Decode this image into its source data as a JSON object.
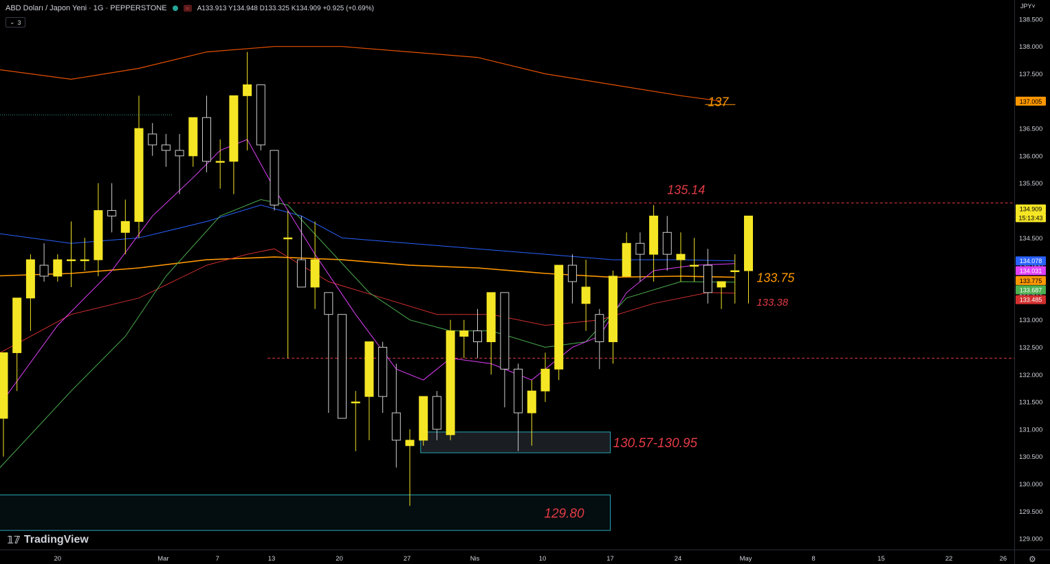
{
  "header": {
    "symbol": "ABD Doları / Japon Yeni · 1G · PEPPERSTONE",
    "ohlc": "A133.913 Y134.948 D133.325 K134.909 +0.925 (+0.69%)",
    "indicator_count": "3"
  },
  "currency_label": "JPY",
  "logo_text": "TradingView",
  "colors": {
    "bull": "#f5e625",
    "bear": "#000000",
    "axis_text": "#d1d4dc",
    "level_line": "#c0282e",
    "zone_border": "#2aa7b8"
  },
  "chart_data": {
    "type": "candlestick",
    "ylim": [
      128.8,
      138.85
    ],
    "y_ticks": [
      129.0,
      129.5,
      130.0,
      130.5,
      131.0,
      131.5,
      132.0,
      132.5,
      133.0,
      133.5,
      134.0,
      134.5,
      135.0,
      135.5,
      136.0,
      136.5,
      137.0,
      137.5,
      138.0,
      138.5
    ],
    "x_ticks": [
      {
        "label": "13",
        "i": -1
      },
      {
        "label": "20",
        "i": 4
      },
      {
        "label": "Mar",
        "i": 11.8
      },
      {
        "label": "7",
        "i": 15.8
      },
      {
        "label": "13",
        "i": 19.8
      },
      {
        "label": "20",
        "i": 24.8
      },
      {
        "label": "27",
        "i": 29.8
      },
      {
        "label": "Nis",
        "i": 34.8
      },
      {
        "label": "10",
        "i": 39.8
      },
      {
        "label": "17",
        "i": 44.8
      },
      {
        "label": "24",
        "i": 49.8
      },
      {
        "label": "May",
        "i": 54.8
      },
      {
        "label": "8",
        "i": 59.8
      },
      {
        "label": "15",
        "i": 64.8
      },
      {
        "label": "22",
        "i": 69.8
      },
      {
        "label": "26",
        "i": 73.8
      }
    ],
    "ohlc": [
      [
        131.2,
        131.6,
        130.5,
        132.4
      ],
      [
        132.4,
        133.3,
        131.7,
        133.4
      ],
      [
        133.4,
        134.2,
        132.8,
        134.1
      ],
      [
        134.0,
        134.4,
        133.7,
        133.8
      ],
      [
        133.8,
        134.2,
        133.7,
        134.1
      ],
      [
        134.1,
        134.8,
        133.6,
        134.1
      ],
      [
        134.1,
        134.5,
        133.9,
        134.1
      ],
      [
        134.1,
        135.5,
        133.8,
        135.0
      ],
      [
        135.0,
        135.5,
        134.6,
        134.9
      ],
      [
        134.6,
        135.2,
        134.2,
        134.8
      ],
      [
        134.8,
        137.1,
        134.5,
        136.5
      ],
      [
        136.4,
        136.6,
        136.0,
        136.2
      ],
      [
        136.2,
        136.4,
        135.8,
        136.1
      ],
      [
        136.1,
        136.4,
        135.3,
        136.0
      ],
      [
        136.0,
        136.7,
        135.8,
        136.7
      ],
      [
        136.7,
        137.1,
        135.7,
        135.9
      ],
      [
        135.9,
        136.3,
        135.4,
        135.9
      ],
      [
        135.9,
        137.1,
        135.3,
        137.1
      ],
      [
        137.1,
        137.9,
        136.1,
        137.3
      ],
      [
        137.3,
        137.3,
        136.1,
        136.2
      ],
      [
        136.1,
        136.1,
        135.0,
        135.1
      ],
      [
        134.5,
        135.0,
        132.3,
        134.5
      ],
      [
        134.1,
        134.9,
        133.7,
        133.6
      ],
      [
        133.6,
        134.8,
        133.2,
        134.1
      ],
      [
        133.5,
        133.5,
        131.3,
        133.1
      ],
      [
        133.1,
        133.1,
        131.2,
        131.2
      ],
      [
        131.5,
        131.7,
        130.6,
        131.5
      ],
      [
        131.6,
        132.5,
        130.8,
        132.6
      ],
      [
        132.5,
        132.6,
        131.3,
        131.6
      ],
      [
        131.3,
        132.2,
        130.3,
        130.8
      ],
      [
        130.7,
        131.0,
        129.6,
        130.8
      ],
      [
        130.8,
        131.6,
        130.7,
        131.6
      ],
      [
        131.6,
        131.7,
        130.8,
        131.0
      ],
      [
        130.9,
        133.0,
        130.8,
        132.8
      ],
      [
        132.7,
        133.0,
        132.3,
        132.8
      ],
      [
        132.8,
        133.2,
        132.3,
        132.6
      ],
      [
        132.6,
        133.3,
        132.0,
        133.5
      ],
      [
        133.5,
        133.5,
        131.4,
        132.1
      ],
      [
        132.1,
        132.2,
        130.6,
        131.3
      ],
      [
        131.3,
        131.9,
        130.7,
        131.7
      ],
      [
        131.7,
        132.4,
        131.5,
        132.1
      ],
      [
        132.1,
        133.8,
        131.9,
        134.0
      ],
      [
        134.0,
        134.2,
        133.3,
        133.7
      ],
      [
        133.3,
        134.1,
        132.8,
        133.6
      ],
      [
        133.1,
        133.2,
        132.1,
        132.6
      ],
      [
        132.6,
        133.9,
        132.2,
        133.8
      ],
      [
        133.8,
        134.6,
        133.8,
        134.4
      ],
      [
        134.4,
        134.6,
        133.7,
        134.2
      ],
      [
        134.2,
        135.1,
        133.7,
        134.9
      ],
      [
        134.6,
        134.9,
        133.9,
        134.2
      ],
      [
        134.1,
        134.6,
        133.7,
        134.2
      ],
      [
        134.0,
        134.5,
        133.7,
        134.0
      ],
      [
        134.0,
        134.3,
        133.3,
        133.5
      ],
      [
        133.6,
        133.7,
        133.2,
        133.7
      ],
      [
        133.9,
        134.2,
        133.3,
        133.9
      ],
      [
        133.9,
        134.9,
        133.3,
        134.9
      ]
    ],
    "moving_averages": [
      {
        "color": "#ff9800",
        "width": 1.6,
        "points": [
          [
            -1,
            133.8
          ],
          [
            5,
            133.85
          ],
          [
            10,
            133.95
          ],
          [
            15,
            134.1
          ],
          [
            20,
            134.15
          ],
          [
            25,
            134.1
          ],
          [
            30,
            134.0
          ],
          [
            35,
            133.95
          ],
          [
            40,
            133.85
          ],
          [
            45,
            133.78
          ],
          [
            50,
            133.8
          ],
          [
            54,
            133.78
          ]
        ]
      },
      {
        "color": "#e65100",
        "width": 1.2,
        "points": [
          [
            -1,
            137.6
          ],
          [
            5,
            137.4
          ],
          [
            10,
            137.6
          ],
          [
            15,
            137.9
          ],
          [
            20,
            138.0
          ],
          [
            25,
            138.0
          ],
          [
            30,
            137.9
          ],
          [
            35,
            137.8
          ],
          [
            40,
            137.5
          ],
          [
            45,
            137.3
          ],
          [
            50,
            137.1
          ],
          [
            53,
            137.0
          ]
        ]
      },
      {
        "color": "#2962ff",
        "width": 1.0,
        "points": [
          [
            -1,
            134.6
          ],
          [
            5,
            134.4
          ],
          [
            10,
            134.5
          ],
          [
            15,
            134.8
          ],
          [
            19,
            135.1
          ],
          [
            22,
            134.9
          ],
          [
            25,
            134.5
          ],
          [
            30,
            134.4
          ],
          [
            35,
            134.3
          ],
          [
            40,
            134.2
          ],
          [
            45,
            134.1
          ],
          [
            50,
            134.1
          ],
          [
            54,
            134.08
          ]
        ]
      },
      {
        "color": "#d32f2f",
        "width": 1.0,
        "points": [
          [
            -1,
            132.3
          ],
          [
            5,
            133.1
          ],
          [
            10,
            133.4
          ],
          [
            15,
            134.0
          ],
          [
            18,
            134.2
          ],
          [
            20,
            134.3
          ],
          [
            24,
            133.7
          ],
          [
            28,
            133.4
          ],
          [
            32,
            133.1
          ],
          [
            36,
            133.1
          ],
          [
            40,
            132.9
          ],
          [
            44,
            133.0
          ],
          [
            48,
            133.3
          ],
          [
            52,
            133.5
          ],
          [
            54,
            133.49
          ]
        ]
      },
      {
        "color": "#4caf50",
        "width": 1.0,
        "points": [
          [
            -1,
            130.1
          ],
          [
            5,
            131.7
          ],
          [
            9,
            132.7
          ],
          [
            12,
            133.8
          ],
          [
            16,
            134.9
          ],
          [
            19,
            135.2
          ],
          [
            21,
            135.1
          ],
          [
            24,
            134.3
          ],
          [
            27,
            133.5
          ],
          [
            30,
            133.0
          ],
          [
            33,
            132.8
          ],
          [
            36,
            132.8
          ],
          [
            40,
            132.5
          ],
          [
            43,
            132.6
          ],
          [
            46,
            133.4
          ],
          [
            50,
            133.7
          ],
          [
            54,
            133.69
          ]
        ]
      },
      {
        "color": "#e040fb",
        "width": 1.0,
        "points": [
          [
            -1,
            131.2
          ],
          [
            4,
            132.9
          ],
          [
            8,
            133.9
          ],
          [
            11,
            134.9
          ],
          [
            14,
            135.6
          ],
          [
            16,
            136.1
          ],
          [
            18,
            136.3
          ],
          [
            20,
            135.4
          ],
          [
            23,
            134.2
          ],
          [
            26,
            133.1
          ],
          [
            29,
            132.1
          ],
          [
            31,
            131.9
          ],
          [
            33,
            132.3
          ],
          [
            36,
            132.2
          ],
          [
            39,
            131.9
          ],
          [
            42,
            132.5
          ],
          [
            44,
            132.7
          ],
          [
            46,
            133.5
          ],
          [
            48,
            133.9
          ],
          [
            51,
            134.0
          ],
          [
            54,
            134.03
          ]
        ]
      }
    ],
    "horizontal_levels": [
      {
        "y": 135.14,
        "from_i": 21,
        "label": "135.14",
        "label_i": 49,
        "color": "#e33b45"
      },
      {
        "y": 132.3,
        "from_i": 19.5,
        "label": "",
        "color": "#e33b45"
      }
    ],
    "zones": [
      {
        "y_top": 130.95,
        "y_bottom": 130.57,
        "from_i": 30.8,
        "to_i": 44.8,
        "label": "130.57-130.95",
        "color": "#e33b45"
      },
      {
        "y_top": 129.8,
        "y_bottom": 129.15,
        "from_i": -1.3,
        "to_i": 44.8,
        "label": "129.80",
        "color": "#e33b45"
      }
    ],
    "annotations": [
      {
        "text": "137",
        "i": 52,
        "y": 137.0,
        "color": "#ff9800"
      },
      {
        "text": "133.75",
        "i": 55.6,
        "y": 133.78,
        "color": "#ff9800"
      },
      {
        "text": "133.38",
        "i": 55.6,
        "y": 133.35,
        "color": "#e33b45"
      }
    ],
    "price_labels": [
      {
        "text": "137.005",
        "y": 137.0,
        "bg": "#ff9800",
        "fg": "#000000"
      },
      {
        "text": "134.909",
        "y": 135.03,
        "bg": "#f5e625",
        "fg": "#000000"
      },
      {
        "text": "15:13:43",
        "y": 134.87,
        "bg": "#f5e625",
        "fg": "#000000"
      },
      {
        "text": "134.078",
        "y": 134.08,
        "bg": "#2962ff",
        "fg": "#ffffff"
      },
      {
        "text": "134.031",
        "y": 133.9,
        "bg": "#e040fb",
        "fg": "#ffffff"
      },
      {
        "text": "133.775",
        "y": 133.72,
        "bg": "#ff9800",
        "fg": "#000000"
      },
      {
        "text": "133.687",
        "y": 133.55,
        "bg": "#4caf50",
        "fg": "#ffffff"
      },
      {
        "text": "133.485",
        "y": 133.37,
        "bg": "#d32f2f",
        "fg": "#ffffff"
      }
    ]
  }
}
